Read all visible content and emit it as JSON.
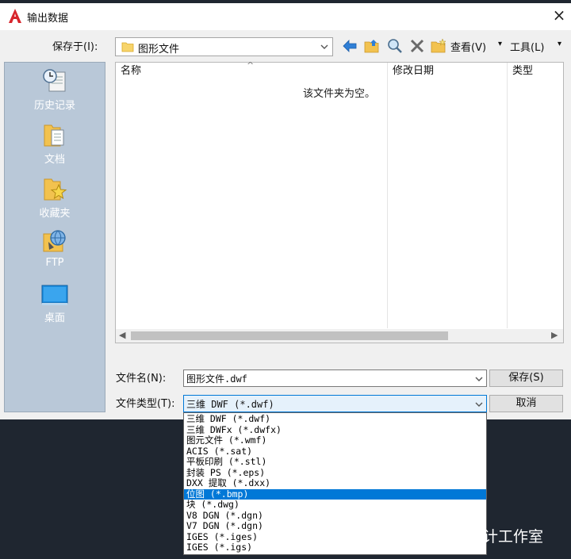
{
  "window": {
    "title": "输出数据",
    "close_label": "×"
  },
  "toolbar": {
    "save_in_label": "保存于(I):",
    "save_in_value": "图形文件",
    "view_label": "查看(V)",
    "tools_label": "工具(L)"
  },
  "places": [
    {
      "label": "历史记录",
      "icon": "history-icon"
    },
    {
      "label": "文档",
      "icon": "documents-folder-icon"
    },
    {
      "label": "收藏夹",
      "icon": "favorites-folder-icon"
    },
    {
      "label": "FTP",
      "icon": "ftp-icon"
    },
    {
      "label": "桌面",
      "icon": "desktop-icon"
    }
  ],
  "file_list": {
    "columns": [
      "名称",
      "修改日期",
      "类型"
    ],
    "empty_message": "该文件夹为空。"
  },
  "form": {
    "file_name_label": "文件名(N):",
    "file_name_value": "图形文件.dwf",
    "file_type_label": "文件类型(T):",
    "file_type_value": "三维 DWF (*.dwf)",
    "save_button": "保存(S)",
    "cancel_button": "取消"
  },
  "file_type_options": [
    "三维 DWF (*.dwf)",
    "三维 DWFx (*.dwfx)",
    "图元文件 (*.wmf)",
    "ACIS (*.sat)",
    "平板印刷 (*.stl)",
    "封装 PS (*.eps)",
    "DXX 提取 (*.dxx)",
    "位图 (*.bmp)",
    "块 (*.dwg)",
    "V8 DGN (*.dgn)",
    "V7 DGN (*.dgn)",
    "IGES (*.iges)",
    "IGES (*.igs)"
  ],
  "selected_option_index": 7,
  "watermark": "知乎 @沙粒设计工作室",
  "colors": {
    "accent": "#0078d7",
    "places_bg": "#b9c8d8",
    "title_icon": "#d7262d"
  }
}
